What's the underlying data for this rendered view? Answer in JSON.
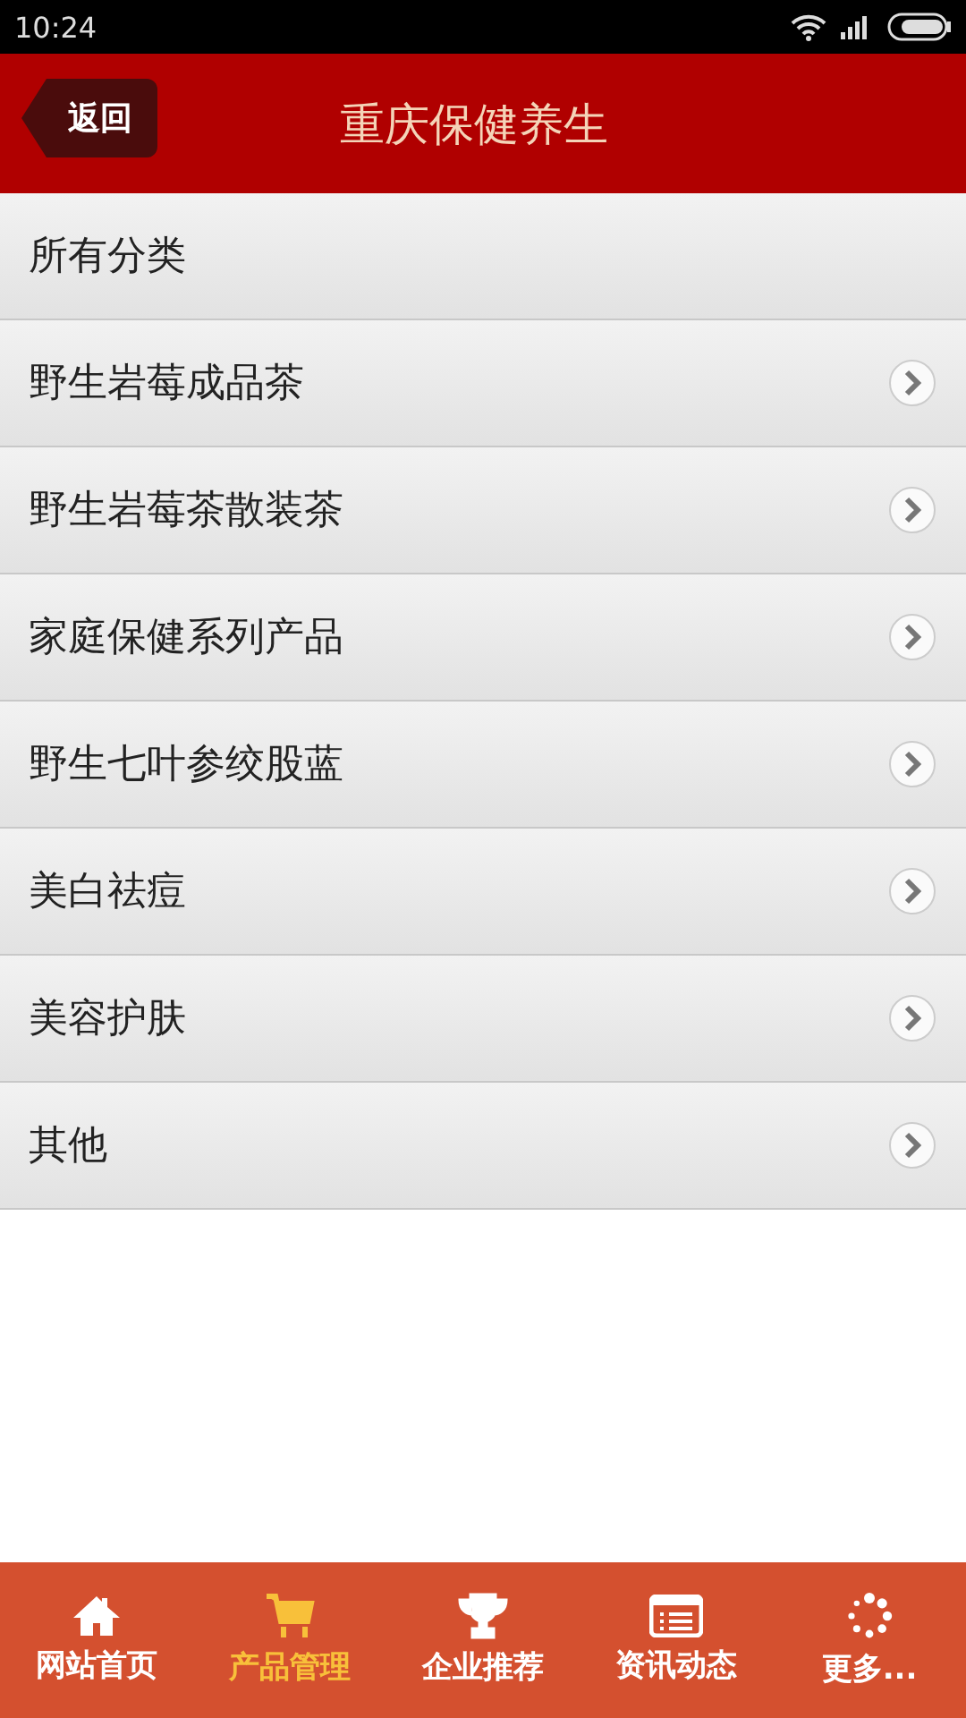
{
  "status_bar": {
    "time": "10:24"
  },
  "header": {
    "back": "返回",
    "title": "重庆保健养生"
  },
  "categories": [
    {
      "label": "所有分类",
      "kind": "all"
    },
    {
      "label": "野生岩莓成品茶",
      "kind": "link"
    },
    {
      "label": "野生岩莓茶散装茶",
      "kind": "link"
    },
    {
      "label": "家庭保健系列产品",
      "kind": "link"
    },
    {
      "label": "野生七叶参绞股蓝",
      "kind": "link"
    },
    {
      "label": "美白祛痘",
      "kind": "link"
    },
    {
      "label": "美容护肤",
      "kind": "link"
    },
    {
      "label": "其他",
      "kind": "link"
    }
  ],
  "tab_bar": [
    {
      "label": "网站首页",
      "kind": "home",
      "selected": false
    },
    {
      "label": "产品管理",
      "kind": "cart",
      "selected": true
    },
    {
      "label": "企业推荐",
      "kind": "trophy",
      "selected": false
    },
    {
      "label": "资讯动态",
      "kind": "news",
      "selected": false
    },
    {
      "label": "更多...",
      "kind": "more",
      "selected": false
    }
  ]
}
